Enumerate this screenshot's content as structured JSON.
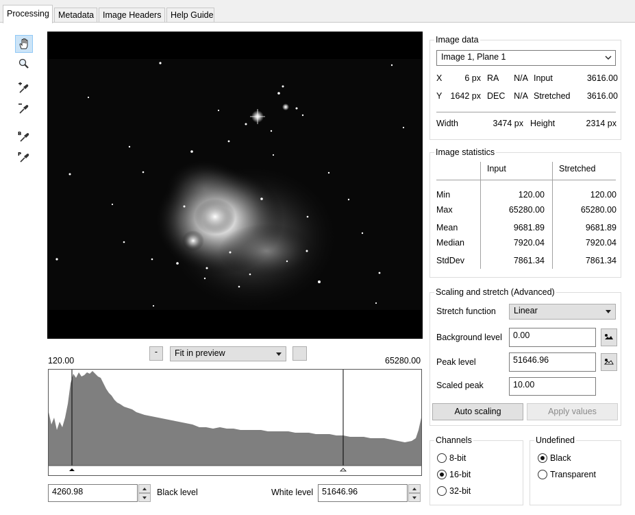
{
  "tabs": [
    {
      "label": "Processing",
      "active": true
    },
    {
      "label": "Metadata"
    },
    {
      "label": "Image Headers"
    },
    {
      "label": "Help Guide"
    }
  ],
  "toolbar": [
    "hand-tool-icon",
    "zoom-tool-icon",
    "eyedropper-add-icon",
    "eyedropper-remove-icon",
    "eyedropper-black-point-icon",
    "eyedropper-peak-icon"
  ],
  "preview": {
    "zoom_minus": "-",
    "zoom_mode": "Fit in preview",
    "hist_min": "120.00",
    "hist_max": "65280.00",
    "black_level_value": "4260.98",
    "black_level_label": "Black level",
    "white_level_label": "White level",
    "white_level_value": "51646.96"
  },
  "image_data": {
    "title": "Image data",
    "selector": "Image 1, Plane 1",
    "x_label": "X",
    "x_value": "6 px",
    "ra_label": "RA",
    "ra_value": "N/A",
    "input_label": "Input",
    "input_value": "3616.00",
    "y_label": "Y",
    "y_value": "1642 px",
    "dec_label": "DEC",
    "dec_value": "N/A",
    "stretched_label": "Stretched",
    "stretched_value": "3616.00",
    "width_label": "Width",
    "width_value": "3474 px",
    "height_label": "Height",
    "height_value": "2314 px"
  },
  "image_statistics": {
    "title": "Image statistics",
    "col_input": "Input",
    "col_stretched": "Stretched",
    "rows": [
      {
        "label": "Min",
        "input": "120.00",
        "stretched": "120.00"
      },
      {
        "label": "Max",
        "input": "65280.00",
        "stretched": "65280.00"
      },
      {
        "label": "Mean",
        "input": "9681.89",
        "stretched": "9681.89"
      },
      {
        "label": "Median",
        "input": "7920.04",
        "stretched": "7920.04"
      },
      {
        "label": "StdDev",
        "input": "7861.34",
        "stretched": "7861.34"
      }
    ]
  },
  "scaling": {
    "title": "Scaling and stretch (Advanced)",
    "stretch_label": "Stretch function",
    "stretch_value": "Linear",
    "background_label": "Background level",
    "background_value": "0.00",
    "peak_label": "Peak level",
    "peak_value": "51646.96",
    "scaled_peak_label": "Scaled peak",
    "scaled_peak_value": "10.00",
    "auto_button": "Auto scaling",
    "apply_button": "Apply values"
  },
  "channels": {
    "title": "Channels",
    "options": [
      "8-bit",
      "16-bit",
      "32-bit"
    ],
    "selected": "16-bit"
  },
  "undefined": {
    "title": "Undefined",
    "options": [
      "Black",
      "Transparent"
    ],
    "selected": "Black"
  },
  "colors": {
    "selection": "#cce4f7",
    "histogram": "#7f7f7f"
  }
}
